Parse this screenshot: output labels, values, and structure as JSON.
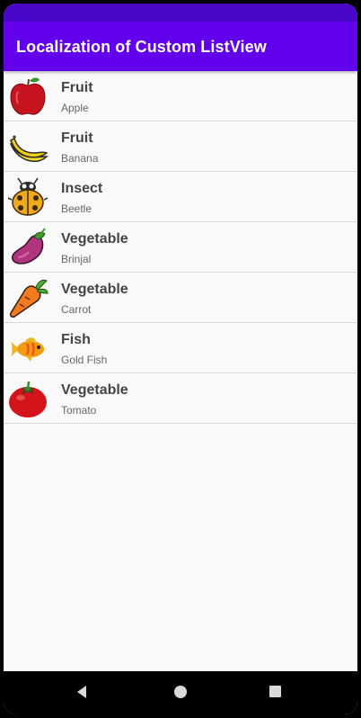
{
  "app": {
    "title": "Localization of Custom ListView"
  },
  "items": [
    {
      "title": "Fruit",
      "subtitle": "Apple",
      "icon": "apple-icon"
    },
    {
      "title": "Fruit",
      "subtitle": "Banana",
      "icon": "banana-icon"
    },
    {
      "title": "Insect",
      "subtitle": "Beetle",
      "icon": "beetle-icon"
    },
    {
      "title": "Vegetable",
      "subtitle": "Brinjal",
      "icon": "eggplant-icon"
    },
    {
      "title": "Vegetable",
      "subtitle": "Carrot",
      "icon": "carrot-icon"
    },
    {
      "title": "Fish",
      "subtitle": "Gold Fish",
      "icon": "goldfish-icon"
    },
    {
      "title": "Vegetable",
      "subtitle": "Tomato",
      "icon": "tomato-icon"
    }
  ],
  "nav": {
    "back": "back-icon",
    "home": "home-icon",
    "recents": "recents-icon"
  }
}
